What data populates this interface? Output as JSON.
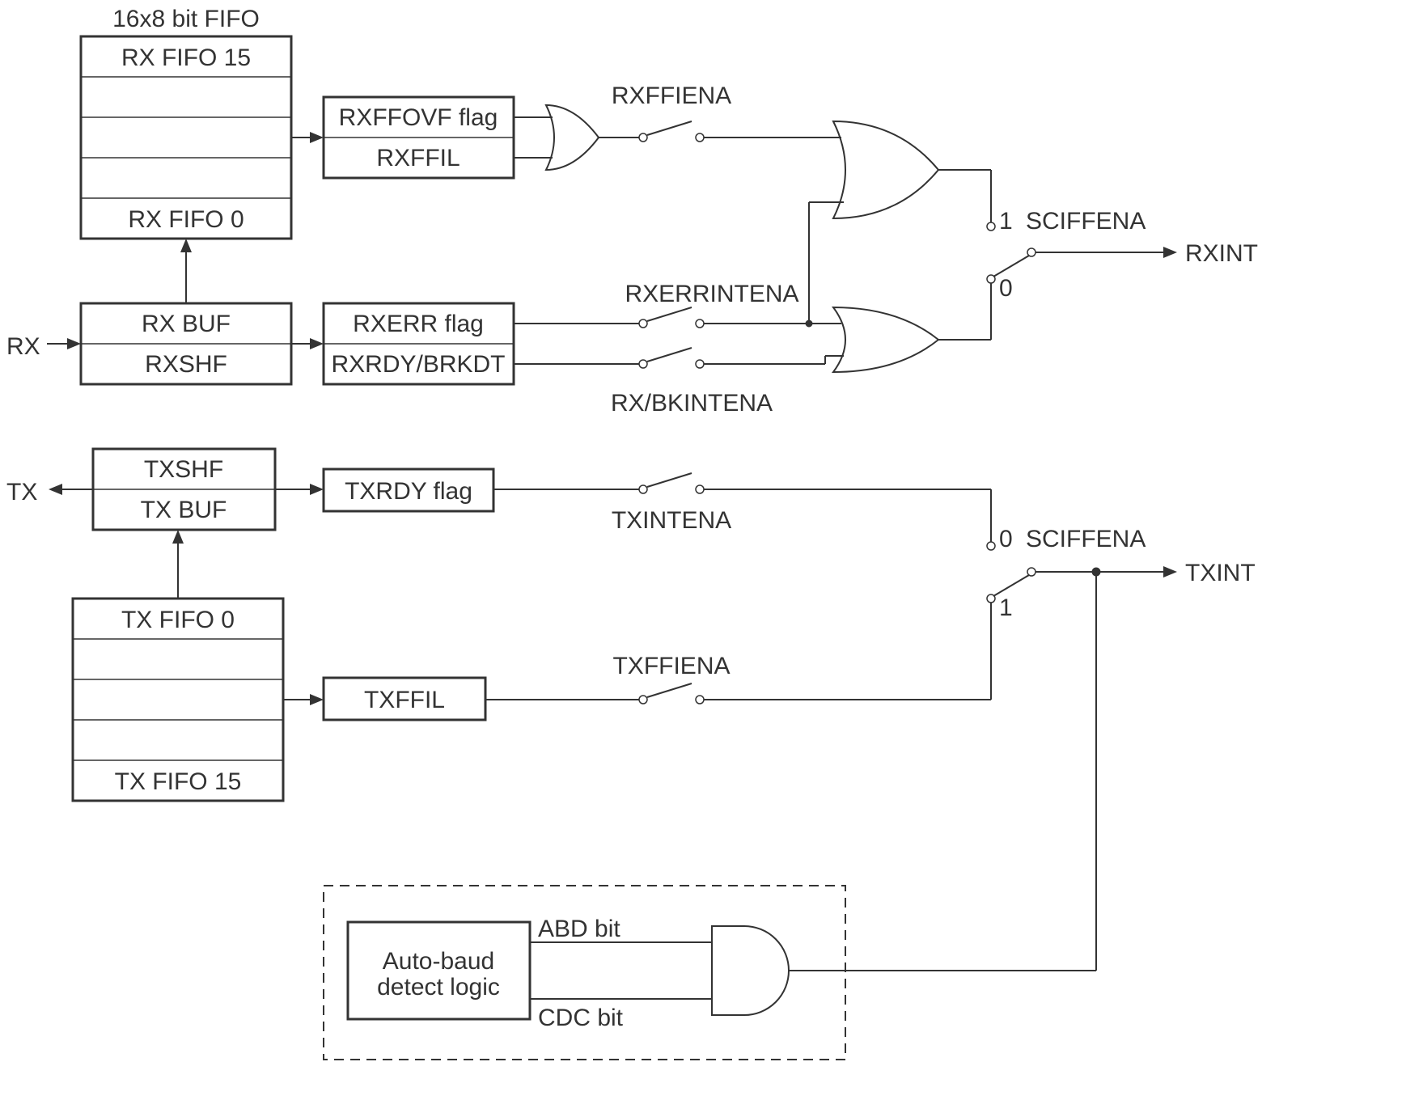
{
  "title": "16x8 bit FIFO",
  "rx_fifo": {
    "top": "RX FIFO 15",
    "bottom": "RX FIFO 0"
  },
  "tx_fifo": {
    "top": "TX FIFO 0",
    "bottom": "TX FIFO 15"
  },
  "rx_buf": {
    "top": "RX BUF",
    "bottom": "RXSHF"
  },
  "tx_buf": {
    "top": "TXSHF",
    "bottom": "TX BUF"
  },
  "rxff_box": {
    "top": "RXFFOVF flag",
    "bottom": "RXFFIL"
  },
  "rxerr_box": {
    "top": "RXERR flag",
    "bottom": "RXRDY/BRKDT"
  },
  "txrdy_box": "TXRDY flag",
  "txffil_box": "TXFFIL",
  "labels": {
    "rx": "RX",
    "tx": "TX",
    "rxffiena": "RXFFIENA",
    "rxerrintena": "RXERRINTENA",
    "rxbkintena": "RX/BKINTENA",
    "txintena": "TXINTENA",
    "txffiena": "TXFFIENA",
    "sciffena_rx": "SCIFFENA",
    "sciffena_tx": "SCIFFENA",
    "rxint": "RXINT",
    "txint": "TXINT",
    "one": "1",
    "zero": "0",
    "one2": "1",
    "zero2": "0",
    "abd": "Auto-baud detect logic",
    "abd_bit": "ABD bit",
    "cdc_bit": "CDC bit"
  }
}
